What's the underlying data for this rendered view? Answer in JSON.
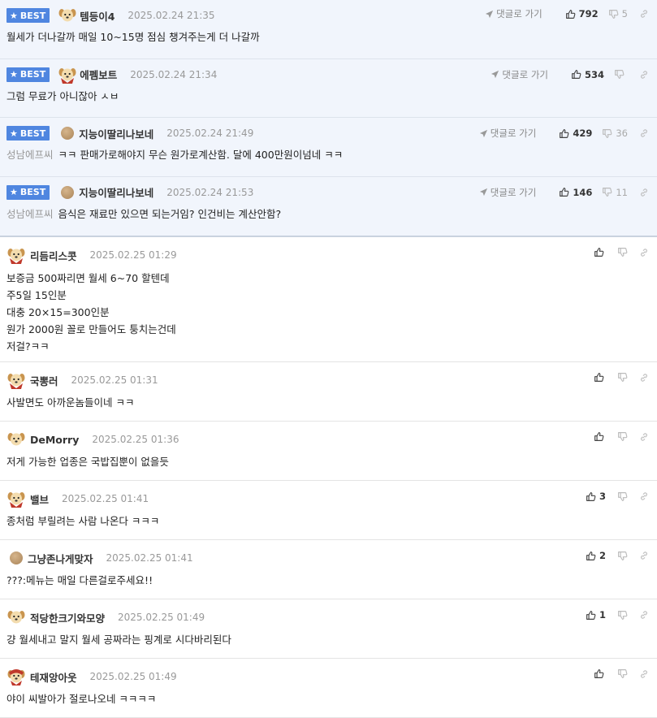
{
  "best_label": "BEST",
  "goto_label": "댓글로 가기",
  "best": [
    {
      "nick": "템등이4",
      "date": "2025.02.24 21:35",
      "avatar": "dog",
      "prefix": "",
      "text": "월세가 더나갈까 매일 10~15명 점심 챙겨주는게 더 나갈까",
      "likes": "792",
      "dislikes": "5"
    },
    {
      "nick": "에펨보트",
      "date": "2025.02.24 21:34",
      "avatar": "dog-cape",
      "prefix": "",
      "text": "그럼 무료가 아니잖아 ㅅㅂ",
      "likes": "534",
      "dislikes": ""
    },
    {
      "nick": "지능이딸리나보네",
      "date": "2025.02.24 21:49",
      "avatar": "ball",
      "prefix": "성남에프씨",
      "text": "ㅋㅋ 판매가로해야지 무슨 원가로계산함. 달에 400만원이넘네 ㅋㅋ",
      "likes": "429",
      "dislikes": "36"
    },
    {
      "nick": "지능이딸리나보네",
      "date": "2025.02.24 21:53",
      "avatar": "ball",
      "prefix": "성남에프씨",
      "text": "음식은 재료만 있으면 되는거임? 인건비는 계산안함?",
      "likes": "146",
      "dislikes": "11"
    }
  ],
  "comments": [
    {
      "nick": "리듬리스콧",
      "date": "2025.02.25 01:29",
      "avatar": "dog-cape",
      "lines": [
        "보증금 500짜리면 월세 6~70 할텐데",
        "주5일 15인분",
        "대충 20×15=300인분",
        "원가 2000원 꼴로 만들어도 퉁치는건데",
        "저걸?ㅋㅋ"
      ],
      "likes": ""
    },
    {
      "nick": "국뽕러",
      "date": "2025.02.25 01:31",
      "avatar": "dog-cape",
      "lines": [
        "사발면도 아까운놈들이네 ㅋㅋ"
      ],
      "likes": ""
    },
    {
      "nick": "DeMorry",
      "date": "2025.02.25 01:36",
      "avatar": "dog",
      "lines": [
        "저게 가능한 업종은 국밥집뿐이 없을듯"
      ],
      "likes": ""
    },
    {
      "nick": "밸브",
      "date": "2025.02.25 01:41",
      "avatar": "dog-cape",
      "lines": [
        "종처럼 부릴려는 사람 나온다 ㅋㅋㅋ"
      ],
      "likes": "3"
    },
    {
      "nick": "그냥존나게맞자",
      "date": "2025.02.25 01:41",
      "avatar": "ball",
      "lines": [
        "???:메뉴는 매일 다른걸로주세요!!"
      ],
      "likes": "2"
    },
    {
      "nick": "적당한크기와모양",
      "date": "2025.02.25 01:49",
      "avatar": "dog",
      "lines": [
        "걍 월세내고 말지 월세 공짜라는 핑계로 시다바리된다"
      ],
      "likes": "1"
    },
    {
      "nick": "테재앙아웃",
      "date": "2025.02.25 01:49",
      "avatar": "dog-red",
      "lines": [
        "야이 씨발아가 절로나오네 ㅋㅋㅋㅋ"
      ],
      "likes": ""
    }
  ],
  "colors": {
    "best_bg": "#f1f5fc",
    "badge": "#4f86e0"
  }
}
